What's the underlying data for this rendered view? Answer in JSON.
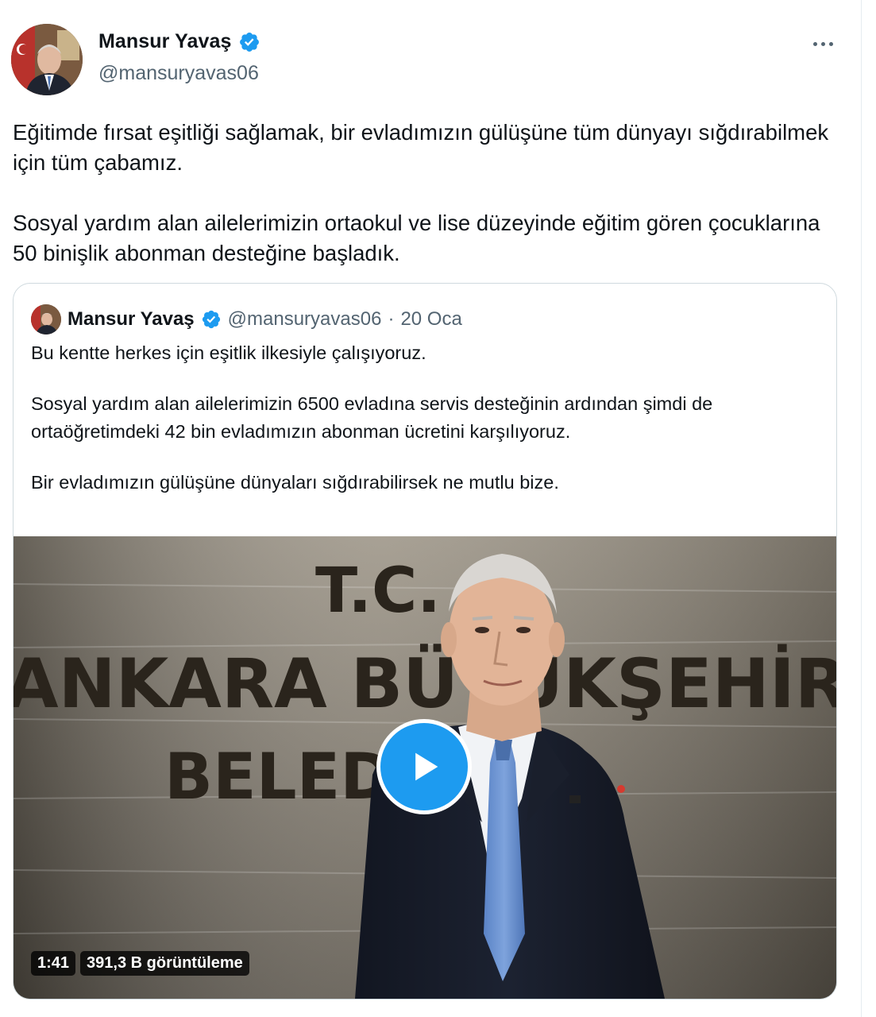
{
  "tweet": {
    "author": {
      "display_name": "Mansur Yavaş",
      "handle": "@mansuryavas06",
      "verified": true
    },
    "more_icon": "more-horizontal-icon",
    "paragraphs": [
      "Eğitimde fırsat eşitliği sağlamak, bir evladımızın gülüşüne tüm dünyayı sığdırabilmek için tüm çabamız.",
      "Sosyal yardım alan ailelerimizin ortaokul ve lise düzeyinde eğitim gören çocuklarına 50 binişlik abonman desteğine başladık."
    ]
  },
  "quote": {
    "author": {
      "display_name": "Mansur Yavaş",
      "handle": "@mansuryavas06",
      "separator": "·",
      "date": "20 Oca"
    },
    "paragraphs": [
      "Bu kentte herkes için eşitlik ilkesiyle çalışıyoruz.",
      "Sosyal yardım alan ailelerimizin 6500 evladına servis desteğinin ardından şimdi de ortaöğretimdeki 42 bin evladımızın abonman ücretini karşılıyoruz.",
      "Bir evladımızın gülüşüne dünyaları sığdırabilirsek ne mutlu bize."
    ],
    "video": {
      "duration": "1:41",
      "views": "391,3 B görüntüleme",
      "wall_sign_lines": [
        "T.C.",
        "ANKARA BÜYÜKŞEHİR",
        "BELEDİYESİ"
      ]
    }
  },
  "colors": {
    "text": "#0f1419",
    "secondary": "#536471",
    "accent": "#1d9bf0",
    "border": "#cfd9de"
  }
}
